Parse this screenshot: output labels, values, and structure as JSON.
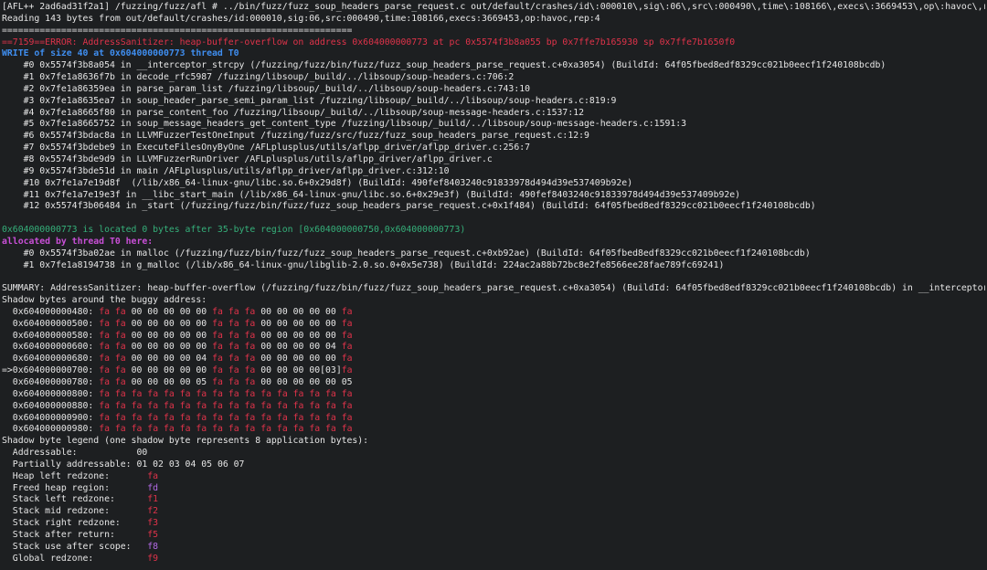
{
  "terminal": {
    "colors": {
      "background": "#1d1f21",
      "foreground": "#e6e6e6",
      "error": "#e0334a",
      "write_header": "#3f8ef0",
      "location": "#35b07a",
      "allocated": "#c84fd6",
      "heap_left_redzone": "#e0334a",
      "freed_heap_region": "#b36ae6"
    },
    "header": [
      "[AFL++ 2ad6ad31f2a1] /fuzzing/fuzz/afl # ../bin/fuzz/fuzz_soup_headers_parse_request.c out/default/crashes/id\\:000010\\,sig\\:06\\,src\\:000490\\,time\\:108166\\,execs\\:3669453\\,op\\:havoc\\,rep\\:4",
      "Reading 143 bytes from out/default/crashes/id:000010,sig:06,src:000490,time:108166,execs:3669453,op:havoc,rep:4",
      "================================================================="
    ],
    "error_line": "==7159==ERROR: AddressSanitizer: heap-buffer-overflow on address 0x604000000773 at pc 0x5574f3b8a055 bp 0x7ffe7b165930 sp 0x7ffe7b1650f0",
    "write_line": "WRITE of size 40 at 0x604000000773 thread T0",
    "stack": [
      "    #0 0x5574f3b8a054 in __interceptor_strcpy (/fuzzing/fuzz/bin/fuzz/fuzz_soup_headers_parse_request.c+0xa3054) (BuildId: 64f05fbed8edf8329cc021b0eecf1f240108bcdb)",
      "    #1 0x7fe1a8636f7b in decode_rfc5987 /fuzzing/libsoup/_build/../libsoup/soup-headers.c:706:2",
      "    #2 0x7fe1a86359ea in parse_param_list /fuzzing/libsoup/_build/../libsoup/soup-headers.c:743:10",
      "    #3 0x7fe1a8635ea7 in soup_header_parse_semi_param_list /fuzzing/libsoup/_build/../libsoup/soup-headers.c:819:9",
      "    #4 0x7fe1a8665f80 in parse_content_foo /fuzzing/libsoup/_build/../libsoup/soup-message-headers.c:1537:12",
      "    #5 0x7fe1a8665752 in soup_message_headers_get_content_type /fuzzing/libsoup/_build/../libsoup/soup-message-headers.c:1591:3",
      "    #6 0x5574f3bdac8a in LLVMFuzzerTestOneInput /fuzzing/fuzz/src/fuzz/fuzz_soup_headers_parse_request.c:12:9",
      "    #7 0x5574f3bdebe9 in ExecuteFilesOnyByOne /AFLplusplus/utils/aflpp_driver/aflpp_driver.c:256:7",
      "    #8 0x5574f3bde9d9 in LLVMFuzzerRunDriver /AFLplusplus/utils/aflpp_driver/aflpp_driver.c",
      "    #9 0x5574f3bde51d in main /AFLplusplus/utils/aflpp_driver/aflpp_driver.c:312:10",
      "    #10 0x7fe1a7e19d8f  (/lib/x86_64-linux-gnu/libc.so.6+0x29d8f) (BuildId: 490fef8403240c91833978d494d39e537409b92e)",
      "    #11 0x7fe1a7e19e3f in __libc_start_main (/lib/x86_64-linux-gnu/libc.so.6+0x29e3f) (BuildId: 490fef8403240c91833978d494d39e537409b92e)",
      "    #12 0x5574f3b06484 in _start (/fuzzing/fuzz/bin/fuzz/fuzz_soup_headers_parse_request.c+0x1f484) (BuildId: 64f05fbed8edf8329cc021b0eecf1f240108bcdb)"
    ],
    "location_line": "0x604000000773 is located 0 bytes after 35-byte region [0x604000000750,0x604000000773)",
    "allocated_line": "allocated by thread T0 here:",
    "alloc_stack": [
      "    #0 0x5574f3ba02ae in malloc (/fuzzing/fuzz/bin/fuzz/fuzz_soup_headers_parse_request.c+0xb92ae) (BuildId: 64f05fbed8edf8329cc021b0eecf1f240108bcdb)",
      "    #1 0x7fe1a8194738 in g_malloc (/lib/x86_64-linux-gnu/libglib-2.0.so.0+0x5e738) (BuildId: 224ac2a88b72bc8e2fe8566ee28fae789fc69241)"
    ],
    "summary_line": "SUMMARY: AddressSanitizer: heap-buffer-overflow (/fuzzing/fuzz/bin/fuzz/fuzz_soup_headers_parse_request.c+0xa3054) (BuildId: 64f05fbed8edf8329cc021b0eecf1f240108bcdb) in __interceptor_strcpy",
    "shadow_title": "Shadow bytes around the buggy address:",
    "shadow_rows": [
      {
        "prefix": "  ",
        "addr": "0x604000000480:",
        "bytes": [
          "fa",
          "fa",
          "00",
          "00",
          "00",
          "00",
          "00",
          "fa",
          "fa",
          "fa",
          "00",
          "00",
          "00",
          "00",
          "00",
          "fa"
        ]
      },
      {
        "prefix": "  ",
        "addr": "0x604000000500:",
        "bytes": [
          "fa",
          "fa",
          "00",
          "00",
          "00",
          "00",
          "00",
          "fa",
          "fa",
          "fa",
          "00",
          "00",
          "00",
          "00",
          "00",
          "fa"
        ]
      },
      {
        "prefix": "  ",
        "addr": "0x604000000580:",
        "bytes": [
          "fa",
          "fa",
          "00",
          "00",
          "00",
          "00",
          "00",
          "fa",
          "fa",
          "fa",
          "00",
          "00",
          "00",
          "00",
          "00",
          "fa"
        ]
      },
      {
        "prefix": "  ",
        "addr": "0x604000000600:",
        "bytes": [
          "fa",
          "fa",
          "00",
          "00",
          "00",
          "00",
          "00",
          "fa",
          "fa",
          "fa",
          "00",
          "00",
          "00",
          "00",
          "04",
          "fa"
        ]
      },
      {
        "prefix": "  ",
        "addr": "0x604000000680:",
        "bytes": [
          "fa",
          "fa",
          "00",
          "00",
          "00",
          "00",
          "04",
          "fa",
          "fa",
          "fa",
          "00",
          "00",
          "00",
          "00",
          "00",
          "fa"
        ]
      },
      {
        "prefix": "=>",
        "addr": "0x604000000700:",
        "bytes": [
          "fa",
          "fa",
          "00",
          "00",
          "00",
          "00",
          "00",
          "fa",
          "fa",
          "fa",
          "00",
          "00",
          "00",
          "00",
          "[03]",
          "fa"
        ]
      },
      {
        "prefix": "  ",
        "addr": "0x604000000780:",
        "bytes": [
          "fa",
          "fa",
          "00",
          "00",
          "00",
          "00",
          "05",
          "fa",
          "fa",
          "fa",
          "00",
          "00",
          "00",
          "00",
          "00",
          "05"
        ]
      },
      {
        "prefix": "  ",
        "addr": "0x604000000800:",
        "bytes": [
          "fa",
          "fa",
          "fa",
          "fa",
          "fa",
          "fa",
          "fa",
          "fa",
          "fa",
          "fa",
          "fa",
          "fa",
          "fa",
          "fa",
          "fa",
          "fa"
        ]
      },
      {
        "prefix": "  ",
        "addr": "0x604000000880:",
        "bytes": [
          "fa",
          "fa",
          "fa",
          "fa",
          "fa",
          "fa",
          "fa",
          "fa",
          "fa",
          "fa",
          "fa",
          "fa",
          "fa",
          "fa",
          "fa",
          "fa"
        ]
      },
      {
        "prefix": "  ",
        "addr": "0x604000000900:",
        "bytes": [
          "fa",
          "fa",
          "fa",
          "fa",
          "fa",
          "fa",
          "fa",
          "fa",
          "fa",
          "fa",
          "fa",
          "fa",
          "fa",
          "fa",
          "fa",
          "fa"
        ]
      },
      {
        "prefix": "  ",
        "addr": "0x604000000980:",
        "bytes": [
          "fa",
          "fa",
          "fa",
          "fa",
          "fa",
          "fa",
          "fa",
          "fa",
          "fa",
          "fa",
          "fa",
          "fa",
          "fa",
          "fa",
          "fa",
          "fa"
        ]
      }
    ],
    "legend_title": "Shadow byte legend (one shadow byte represents 8 application bytes):",
    "legend": [
      {
        "label": "  Addressable:           ",
        "code": "00",
        "cls": "zz"
      },
      {
        "label": "  Partially addressable: ",
        "code": "01 02 03 04 05 06 07",
        "cls": "zz"
      },
      {
        "label": "  Heap left redzone:       ",
        "code": "fa",
        "cls": "fa"
      },
      {
        "label": "  Freed heap region:       ",
        "code": "fd",
        "cls": "fd"
      },
      {
        "label": "  Stack left redzone:      ",
        "code": "f1",
        "cls": "f1"
      },
      {
        "label": "  Stack mid redzone:       ",
        "code": "f2",
        "cls": "f2"
      },
      {
        "label": "  Stack right redzone:     ",
        "code": "f3",
        "cls": "f3"
      },
      {
        "label": "  Stack after return:      ",
        "code": "f5",
        "cls": "f5"
      },
      {
        "label": "  Stack use after scope:   ",
        "code": "f8",
        "cls": "f8"
      },
      {
        "label": "  Global redzone:          ",
        "code": "f9",
        "cls": "f9"
      }
    ]
  }
}
